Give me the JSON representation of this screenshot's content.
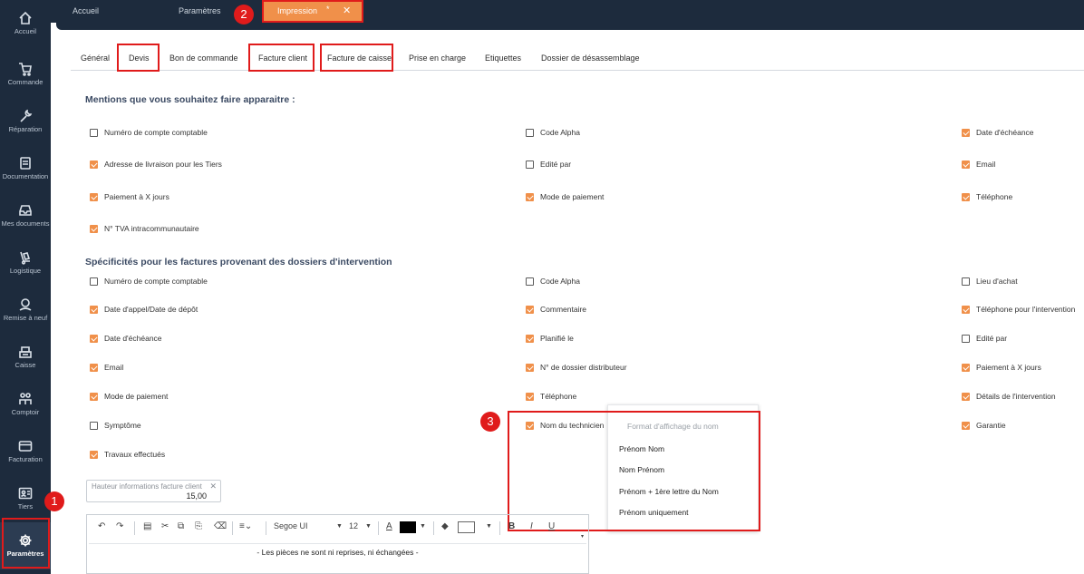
{
  "sidebar": {
    "items": [
      {
        "label": "Accueil",
        "icon": "home-icon"
      },
      {
        "label": "Commande",
        "icon": "cart-icon"
      },
      {
        "label": "Réparation",
        "icon": "wrench-icon"
      },
      {
        "label": "Documentation",
        "icon": "document-icon"
      },
      {
        "label": "Mes documents",
        "icon": "inbox-icon"
      },
      {
        "label": "Logistique",
        "icon": "hand-truck-icon"
      },
      {
        "label": "Remise à neuf",
        "icon": "refurbish-icon"
      },
      {
        "label": "Caisse",
        "icon": "cash-register-icon"
      },
      {
        "label": "Comptoir",
        "icon": "people-icon"
      },
      {
        "label": "Facturation",
        "icon": "card-icon"
      },
      {
        "label": "Tiers",
        "icon": "id-card-icon"
      },
      {
        "label": "Paramètres",
        "icon": "gear-icon"
      }
    ]
  },
  "top_tabs": {
    "accueil": "Accueil",
    "parametres": "Paramètres",
    "impression": "Impression",
    "modified_mark": "*",
    "close": "✕"
  },
  "sub_tabs": [
    "Général",
    "Devis",
    "Bon de commande",
    "Facture client",
    "Facture de caisse",
    "Prise en charge",
    "Etiquettes",
    "Dossier de désassemblage"
  ],
  "badges": [
    "1",
    "2",
    "3"
  ],
  "section1": {
    "title": "Mentions que vous souhaitez faire apparaitre :",
    "col1": [
      {
        "label": "Numéro de compte comptable",
        "checked": false
      },
      {
        "label": "Adresse de livraison pour les Tiers",
        "checked": true
      },
      {
        "label": "Paiement à X jours",
        "checked": true
      },
      {
        "label": "N° TVA intracommunautaire",
        "checked": true
      }
    ],
    "col2": [
      {
        "label": "Code Alpha",
        "checked": false
      },
      {
        "label": "Edité par",
        "checked": false
      },
      {
        "label": "Mode de paiement",
        "checked": true
      }
    ],
    "col3": [
      {
        "label": "Date d'échéance",
        "checked": true
      },
      {
        "label": "Email",
        "checked": true
      },
      {
        "label": "Téléphone",
        "checked": true
      }
    ]
  },
  "section2": {
    "title": "Spécificités pour les factures provenant des dossiers d'intervention",
    "col1": [
      {
        "label": "Numéro de compte comptable",
        "checked": false
      },
      {
        "label": "Date d'appel/Date de dépôt",
        "checked": true
      },
      {
        "label": "Date d'échéance",
        "checked": true
      },
      {
        "label": "Email",
        "checked": true
      },
      {
        "label": "Mode de paiement",
        "checked": true
      },
      {
        "label": "Symptôme",
        "checked": false
      },
      {
        "label": "Travaux effectués",
        "checked": true
      }
    ],
    "col2": [
      {
        "label": "Code Alpha",
        "checked": false
      },
      {
        "label": "Commentaire",
        "checked": true
      },
      {
        "label": "Planifié le",
        "checked": true
      },
      {
        "label": "N° de dossier distributeur",
        "checked": true
      },
      {
        "label": "Téléphone",
        "checked": true
      },
      {
        "label": "Nom du technicien",
        "checked": true
      }
    ],
    "col3": [
      {
        "label": "Lieu d'achat",
        "checked": false
      },
      {
        "label": "Téléphone pour l'intervention",
        "checked": true
      },
      {
        "label": "Edité par",
        "checked": false
      },
      {
        "label": "Paiement à X jours",
        "checked": true
      },
      {
        "label": "Détails de l'intervention",
        "checked": true
      },
      {
        "label": "Garantie",
        "checked": true
      }
    ]
  },
  "dropdown": {
    "header": "Format d'affichage du nom",
    "options": [
      "Prénom Nom",
      "Nom Prénom",
      "Prénom + 1ère lettre du Nom",
      "Prénom uniquement"
    ]
  },
  "hauteur": {
    "label": "Hauteur informations facture client",
    "value": "15,00",
    "clear": "✕"
  },
  "editor": {
    "font": "Segoe UI",
    "size": "12",
    "content": "- Les pièces ne sont ni reprises, ni échangées -"
  },
  "colors": {
    "sidebar": "#1d2b3d",
    "accent": "#f0904a",
    "highlight": "#e01b1b"
  }
}
